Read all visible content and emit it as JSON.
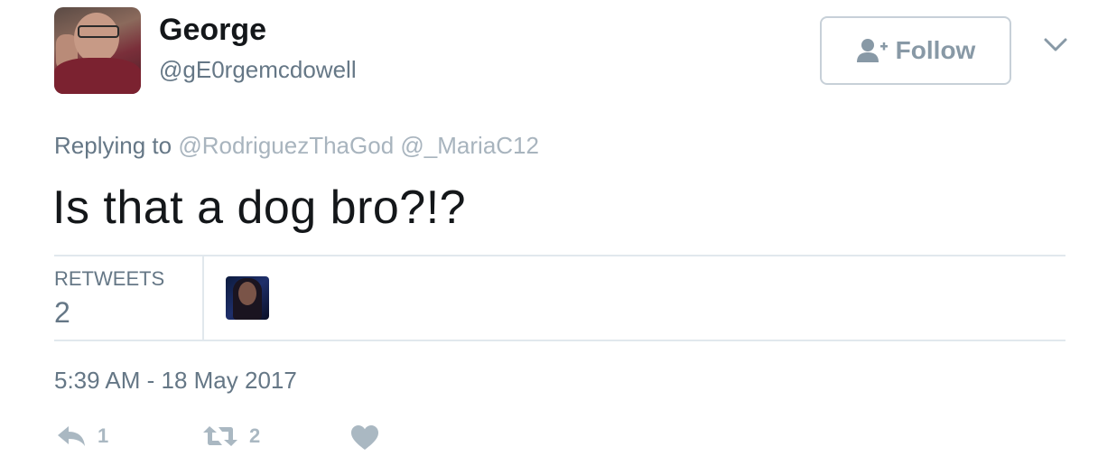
{
  "user": {
    "display_name": "George",
    "handle": "@gE0rgemcdowell"
  },
  "header": {
    "follow_label": "Follow"
  },
  "tweet": {
    "replying_prefix": "Replying to",
    "mention_1": "@RodriguezThaGod",
    "mention_2": "@_MariaC12",
    "text": "Is that a dog bro?!?",
    "timestamp": "5:39 AM - 18 May 2017"
  },
  "stats": {
    "retweets_label": "RETWEETS",
    "retweets_count": "2"
  },
  "actions": {
    "reply_count": "1",
    "retweet_count": "2"
  },
  "icons": [
    "follow-person-icon",
    "chevron-down-icon",
    "reply-icon",
    "retweet-icon",
    "like-heart-icon"
  ],
  "colors": {
    "text_primary": "#14171a",
    "text_secondary": "#657786",
    "icon_gray": "#aab8c2",
    "border": "#e1e8ed"
  }
}
